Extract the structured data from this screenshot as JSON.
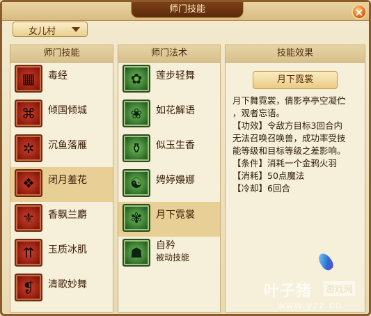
{
  "window": {
    "title": "师门技能"
  },
  "dropdown": {
    "selected": "女儿村"
  },
  "left_panel": {
    "header": "师门技能",
    "items": [
      {
        "name": "毒经",
        "icon": "poison-scripture-icon",
        "selected": false
      },
      {
        "name": "倾国倾城",
        "icon": "beauty-icon",
        "selected": false
      },
      {
        "name": "沉鱼落雁",
        "icon": "fish-goose-icon",
        "selected": false
      },
      {
        "name": "闭月羞花",
        "icon": "moon-flower-icon",
        "selected": true
      },
      {
        "name": "香飘兰麝",
        "icon": "fragrance-icon",
        "selected": false
      },
      {
        "name": "玉质冰肌",
        "icon": "jade-skin-icon",
        "selected": false
      },
      {
        "name": "清歌妙舞",
        "icon": "song-dance-icon",
        "selected": false
      }
    ]
  },
  "middle_panel": {
    "header": "师门法术",
    "items": [
      {
        "name": "莲步轻舞",
        "sub": "",
        "icon": "lotus-step-icon",
        "selected": false
      },
      {
        "name": "如花解语",
        "sub": "",
        "icon": "flower-speech-icon",
        "selected": false
      },
      {
        "name": "似玉生香",
        "sub": "",
        "icon": "jade-fragrance-icon",
        "selected": false
      },
      {
        "name": "娉婷嬝娜",
        "sub": "",
        "icon": "graceful-lips-icon",
        "selected": false
      },
      {
        "name": "月下霓裳",
        "sub": "",
        "icon": "moon-dress-icon",
        "selected": true
      },
      {
        "name": "自矜",
        "sub": "被动技能",
        "icon": "handshake-icon",
        "selected": false
      }
    ]
  },
  "right_panel": {
    "header": "技能效果",
    "skill_title": "月下霓裳",
    "description_lines": [
      "月下舞霓裳，倩影亭亭空凝伫",
      "，观者忘语。",
      "【功效】令敌方目标3回合内",
      "无法召唤召唤兽，成功率受技",
      "能等级和目标等级之差影响。",
      "【条件】消耗一个金鸦火羽",
      "【消耗】50点魔法",
      "【冷却】6回合"
    ]
  },
  "watermark": {
    "brand": "叶子猪",
    "net": "游戏网",
    "url": "www.yzz.cn"
  }
}
